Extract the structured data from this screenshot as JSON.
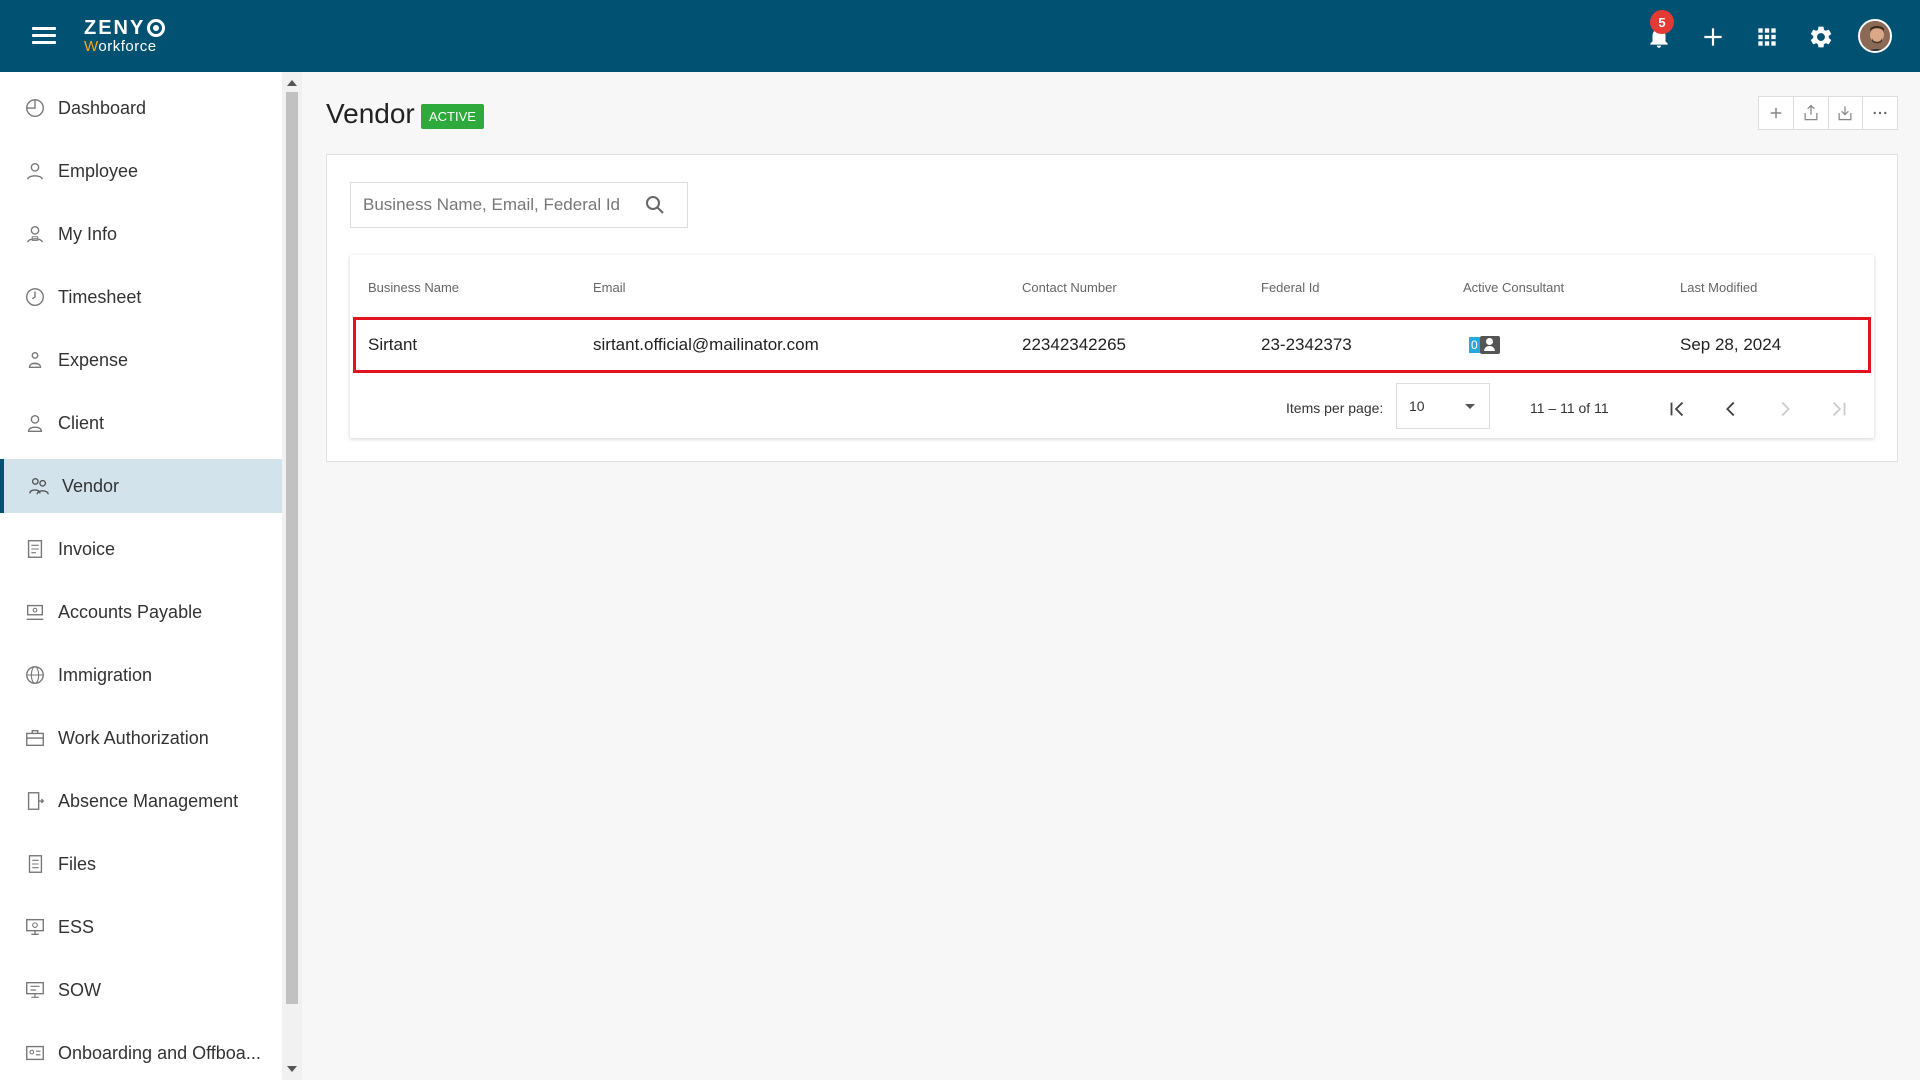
{
  "header": {
    "logo_top": "ZENY",
    "logo_bottom_accent": "W",
    "logo_bottom_rest": "orkforce",
    "notification_count": "5",
    "icons": [
      "menu-icon",
      "bell-icon",
      "plus-icon",
      "apps-grid-icon",
      "gear-icon",
      "avatar"
    ]
  },
  "sidebar": {
    "items": [
      {
        "label": "Dashboard",
        "icon": "dashboard-icon"
      },
      {
        "label": "Employee",
        "icon": "employee-icon"
      },
      {
        "label": "My Info",
        "icon": "my-info-icon"
      },
      {
        "label": "Timesheet",
        "icon": "clock-icon"
      },
      {
        "label": "Expense",
        "icon": "expense-icon"
      },
      {
        "label": "Client",
        "icon": "client-icon"
      },
      {
        "label": "Vendor",
        "icon": "vendor-icon",
        "active": true
      },
      {
        "label": "Invoice",
        "icon": "invoice-icon"
      },
      {
        "label": "Accounts Payable",
        "icon": "accounts-payable-icon"
      },
      {
        "label": "Immigration",
        "icon": "globe-icon"
      },
      {
        "label": "Work Authorization",
        "icon": "briefcase-icon"
      },
      {
        "label": "Absence Management",
        "icon": "door-icon"
      },
      {
        "label": "Files",
        "icon": "files-icon"
      },
      {
        "label": "ESS",
        "icon": "ess-icon"
      },
      {
        "label": "SOW",
        "icon": "sow-icon"
      },
      {
        "label": "Onboarding and Offboa...",
        "icon": "id-card-icon"
      }
    ]
  },
  "main": {
    "title": "Vendor",
    "status": "ACTIVE",
    "search_placeholder": "Business Name, Email, Federal Id",
    "columns": [
      "Business Name",
      "Email",
      "Contact Number",
      "Federal Id",
      "Active Consultant",
      "Last Modified"
    ],
    "rows": [
      {
        "business_name": "Sirtant",
        "email": "sirtant.official@mailinator.com",
        "contact_number": "22342342265",
        "federal_id": "23-2342373",
        "active_consultant": "0",
        "last_modified": "Sep 28, 2024"
      }
    ],
    "pagination": {
      "items_per_page_label": "Items per page:",
      "items_per_page": "10",
      "range": "11 – 11 of 11"
    }
  },
  "colors": {
    "header_bg": "#015272",
    "active_badge": "#2eaa3c",
    "highlight_border": "#e0131f",
    "sidebar_active": "#d3e3ec",
    "notification_badge": "#e53935"
  }
}
